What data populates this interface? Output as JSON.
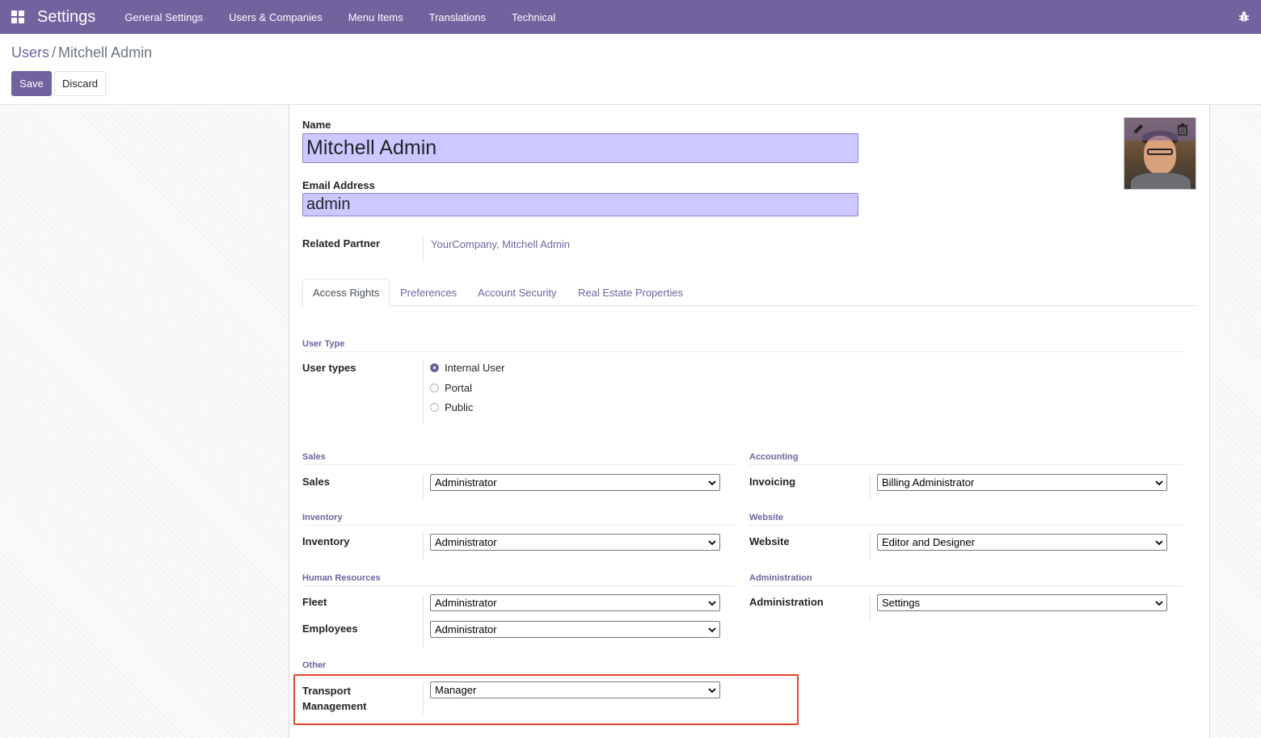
{
  "navbar": {
    "app_title": "Settings",
    "menu": [
      "General Settings",
      "Users & Companies",
      "Menu Items",
      "Translations",
      "Technical"
    ],
    "icons": [
      "apps-grid-icon",
      "bug-icon"
    ],
    "color": "#71639e"
  },
  "breadcrumb": {
    "parent": "Users",
    "separator": "/",
    "current": "Mitchell Admin"
  },
  "actions": {
    "save": "Save",
    "discard": "Discard"
  },
  "form": {
    "name_label": "Name",
    "name_value": "Mitchell Admin",
    "email_label": "Email Address",
    "email_value": "admin",
    "partner_label": "Related Partner",
    "partner_value": "YourCompany, Mitchell Admin",
    "avatar_icons": [
      "pencil-icon",
      "trash-icon"
    ]
  },
  "tabs": [
    "Access Rights",
    "Preferences",
    "Account Security",
    "Real Estate Properties"
  ],
  "active_tab": "Access Rights",
  "user_type": {
    "section": "User Type",
    "label": "User types",
    "options": [
      "Internal User",
      "Portal",
      "Public"
    ],
    "selected": "Internal User"
  },
  "groups": {
    "sales": {
      "section": "Sales",
      "label": "Sales",
      "value": "Administrator"
    },
    "accounting": {
      "section": "Accounting",
      "label": "Invoicing",
      "value": "Billing Administrator"
    },
    "inventory": {
      "section": "Inventory",
      "label": "Inventory",
      "value": "Administrator"
    },
    "website": {
      "section": "Website",
      "label": "Website",
      "value": "Editor and Designer"
    },
    "hr": {
      "section": "Human Resources",
      "fleet_label": "Fleet",
      "fleet_value": "Administrator",
      "employees_label": "Employees",
      "employees_value": "Administrator"
    },
    "administration": {
      "section": "Administration",
      "label": "Administration",
      "value": "Settings"
    },
    "other": {
      "section": "Other",
      "label_line1": "Transport",
      "label_line2": "Management",
      "value": "Manager"
    }
  },
  "highlight_color": "#e8432b"
}
